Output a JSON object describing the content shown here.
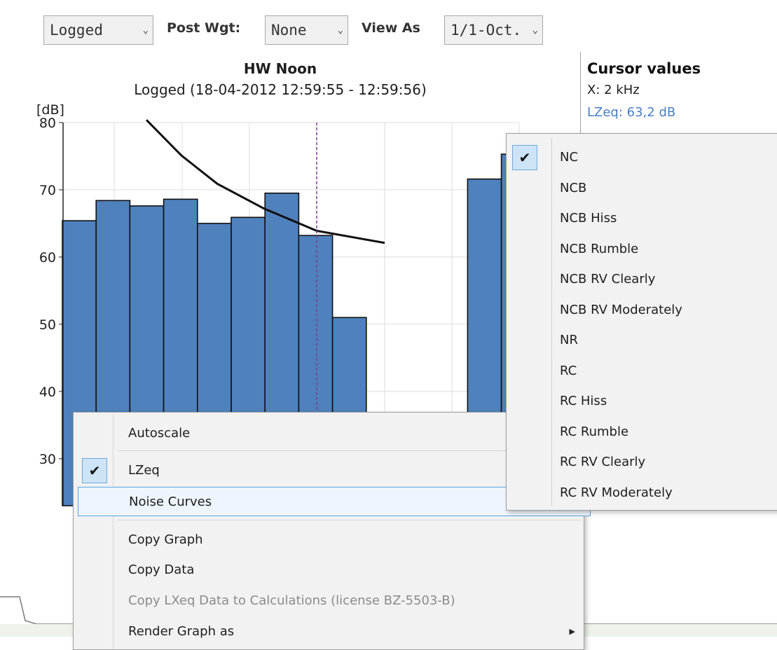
{
  "toolbar": {
    "mode_value": "Logged",
    "post_wgt_label": "Post Wgt:",
    "post_wgt_value": "None",
    "view_as_label": "View As",
    "view_as_value": "1/1-Oct."
  },
  "chart": {
    "title": "HW Noon",
    "subtitle": "Logged (18-04-2012 12:59:55 - 12:59:56)",
    "yunit": "[dB]"
  },
  "chart_data": {
    "type": "bar",
    "ylabel": "[dB]",
    "ylim": [
      23,
      80
    ],
    "yticks": [
      "80",
      "70",
      "60",
      "50",
      "40",
      "30"
    ],
    "grid": true,
    "cursor_x": "2 kHz",
    "series": [
      {
        "values": [
          65.4,
          68.4,
          67.6,
          68.6,
          65.0,
          65.9,
          69.5,
          63.2,
          51.0,
          null,
          null,
          null,
          71.6,
          75.3
        ]
      }
    ],
    "noise_curve": [
      80.4,
      75.1,
      70.9,
      67.2,
      63.9,
      62.1
    ]
  },
  "cursor": {
    "title": "Cursor values",
    "x_text": "X: 2 kHz",
    "l_text": "LZeq: 63,2 dB"
  },
  "context_menu": {
    "autoscale": "Autoscale",
    "lzeq": "LZeq",
    "noise_curves": "Noise Curves",
    "copy_graph": "Copy Graph",
    "copy_data": "Copy Data",
    "copy_lxeq": "Copy LXeq Data to Calculations (license BZ-5503-B)",
    "render_graph": "Render Graph as"
  },
  "noise_submenu": {
    "items": [
      "NC",
      "NCB",
      "NCB Hiss",
      "NCB Rumble",
      "NCB RV Clearly",
      "NCB RV Moderately",
      "NR",
      "RC",
      "RC Hiss",
      "RC Rumble",
      "RC RV Clearly",
      "RC RV Moderately"
    ]
  },
  "colors": {
    "bar_fill": "#4f81bd",
    "cursor_line": "#7b3d8f",
    "cursor_text": "#4a7fc1",
    "menu_highlight": "#cde4f7"
  }
}
